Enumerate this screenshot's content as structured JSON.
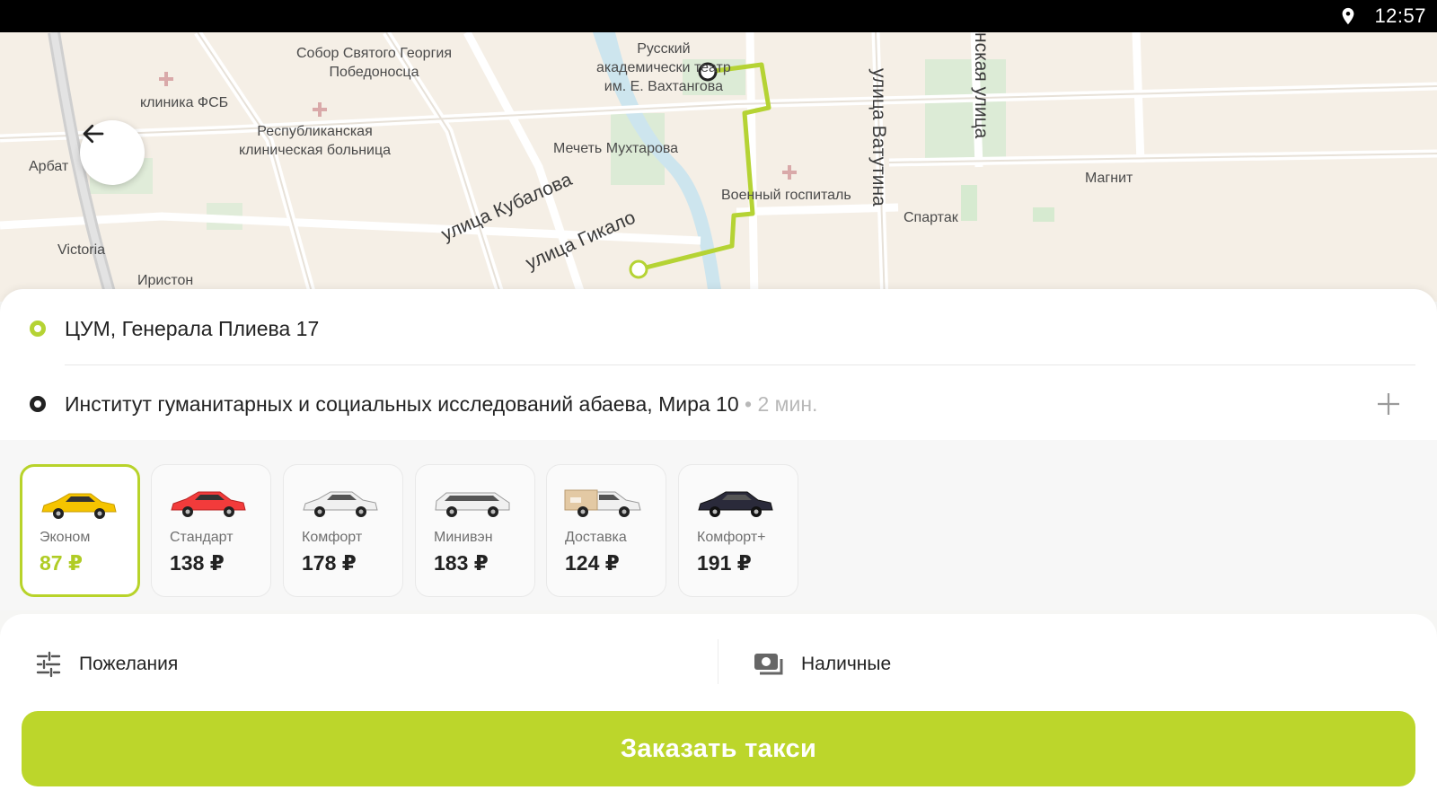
{
  "status_bar": {
    "time": "12:57",
    "icon": "location-pin-icon"
  },
  "map": {
    "labels": {
      "sobor": "Собор Святого Георгия\nПобедоносца",
      "theatre": "Русский\nакадемически  театр\nим. Е. Вахтангова",
      "clinic_fsb": "клиника ФСБ",
      "hospital": "Республиканская\nклиническая больница",
      "mosque": "Мечеть Мухтарова",
      "military_hospital": "Военный госпиталь",
      "magnit": "Магнит",
      "spartak": "Спартак",
      "arbat": "Арбат",
      "victoria": "Victoria",
      "iriston": "Иристон"
    },
    "streets": {
      "kubalova": "улица Кубалова",
      "gikalo": "улица Гикало",
      "vatutina": "улица Ватутина",
      "nskaya": "нская улица"
    }
  },
  "route": {
    "from": {
      "address": "ЦУМ, Генерала Плиева 17"
    },
    "to": {
      "address": "Институт гуманитарных и социальных исследований абаева, Мира 10",
      "eta": "• 2 мин."
    }
  },
  "tariffs": [
    {
      "name": "Эконом",
      "price": "87 ₽",
      "selected": true,
      "car_color": "#f5c400"
    },
    {
      "name": "Стандарт",
      "price": "138 ₽",
      "selected": false,
      "car_color": "#f23b3b"
    },
    {
      "name": "Комфорт",
      "price": "178 ₽",
      "selected": false,
      "car_color": "#f0f0f0"
    },
    {
      "name": "Минивэн",
      "price": "183 ₽",
      "selected": false,
      "car_color": "#f0f0f0"
    },
    {
      "name": "Доставка",
      "price": "124 ₽",
      "selected": false,
      "car_color": "#f0f0f0"
    },
    {
      "name": "Комфорт+",
      "price": "191 ₽",
      "selected": false,
      "car_color": "#2a2a3a"
    }
  ],
  "options": {
    "wishes_label": "Пожелания",
    "payment_label": "Наличные"
  },
  "order_button": "Заказать такси",
  "colors": {
    "accent": "#bcd62b",
    "selected_price": "#b0cc25",
    "route_line": "#b5d334"
  }
}
